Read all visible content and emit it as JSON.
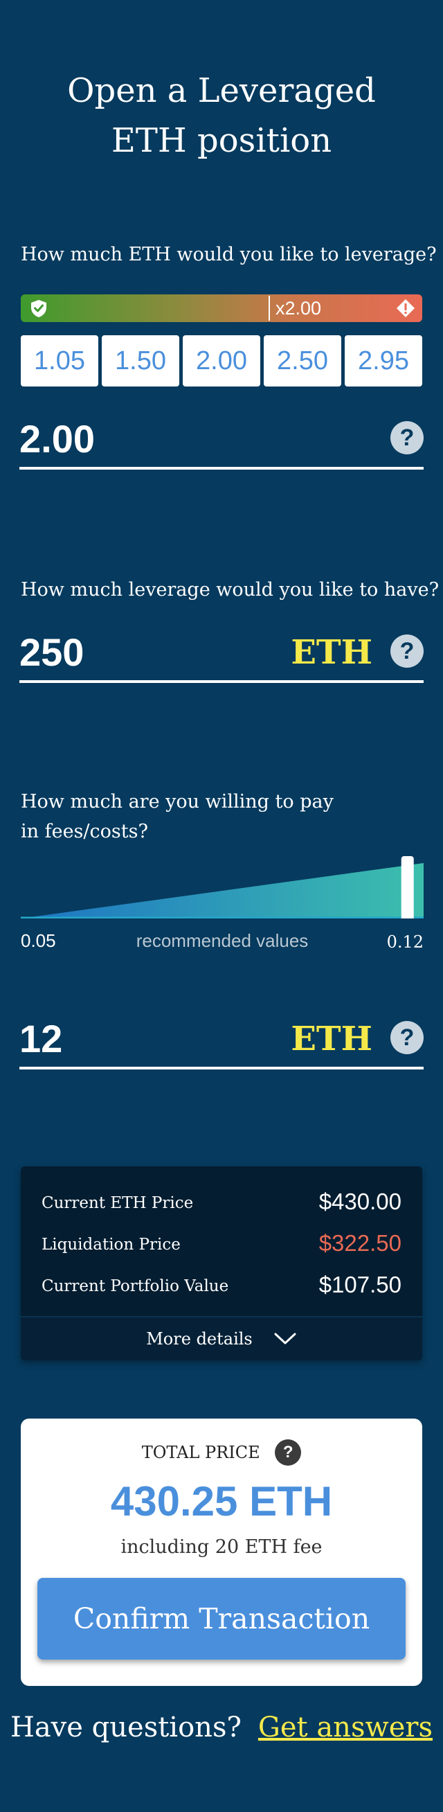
{
  "title": {
    "line1": "Open a Leveraged",
    "line2": "ETH position"
  },
  "leverage_question": "How much ETH would you like to leverage?",
  "leverage_bar": {
    "marker_label": "x2.00",
    "marker_fraction": 0.62
  },
  "presets": [
    "1.05",
    "1.50",
    "2.00",
    "2.50",
    "2.95"
  ],
  "leverage_value": "2.00",
  "amount_question": "How much leverage would you like to have?",
  "amount_value": "250",
  "amount_unit": "ETH",
  "fee_question": {
    "line1": "How much are you willing to pay",
    "line2": "in fees/costs?"
  },
  "fee_slider": {
    "min_label": "0.05",
    "mid_label": "recommended values",
    "max_label": "0.12",
    "position_fraction": 0.96
  },
  "fee_value": "12",
  "fee_unit": "ETH",
  "info": {
    "rows": [
      {
        "label": "Current ETH Price",
        "value": "$430.00"
      },
      {
        "label": "Liquidation Price",
        "value": "$322.50"
      },
      {
        "label": "Current Portfolio Value",
        "value": "$107.50"
      }
    ],
    "more_details": "More details"
  },
  "total": {
    "label": "TOTAL PRICE",
    "amount": "430.25 ETH",
    "fee_note": "including 20 ETH fee",
    "confirm_label": "Confirm Transaction"
  },
  "footer": {
    "question": "Have questions?",
    "link": "Get answers"
  },
  "help_glyph": "?",
  "colors": {
    "background": "#063a5e",
    "accent": "#4a8fdc",
    "highlight": "#f5e94a",
    "danger": "#e96a55"
  },
  "icons": [
    "shield-check-icon",
    "warning-diamond-icon",
    "help-icon",
    "chevron-down-icon"
  ]
}
